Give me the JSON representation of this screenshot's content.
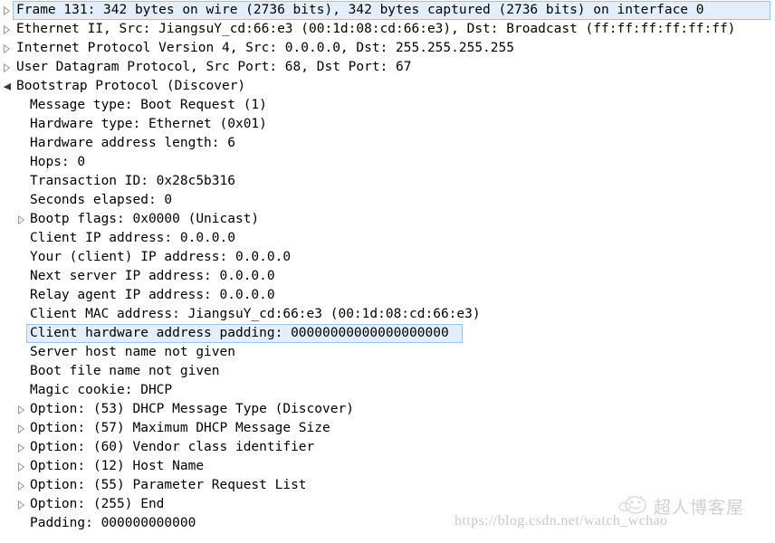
{
  "pane": {
    "name": "Wireshark packet details pane",
    "background": "#ffffff",
    "selection_fill": "#e4eefb",
    "selection_border": "#9fc2e8",
    "text_color": "#000000"
  },
  "tree": {
    "rows": [
      {
        "id": "frame",
        "level": 0,
        "twisty": "collapsed-triangle-icon",
        "selected": true,
        "selection_width": "wide",
        "text": "Frame 131: 342 bytes on wire (2736 bits), 342 bytes captured (2736 bits) on interface 0"
      },
      {
        "id": "ethernet",
        "level": 0,
        "twisty": "collapsed-triangle-icon",
        "selected": false,
        "text": "Ethernet II, Src: JiangsuY_cd:66:e3 (00:1d:08:cd:66:e3), Dst: Broadcast (ff:ff:ff:ff:ff:ff)"
      },
      {
        "id": "ipv4",
        "level": 0,
        "twisty": "collapsed-triangle-icon",
        "selected": false,
        "text": "Internet Protocol Version 4, Src: 0.0.0.0, Dst: 255.255.255.255"
      },
      {
        "id": "udp",
        "level": 0,
        "twisty": "collapsed-triangle-icon",
        "selected": false,
        "text": "User Datagram Protocol, Src Port: 68, Dst Port: 67"
      },
      {
        "id": "bootp",
        "level": 0,
        "twisty": "expanded-triangle-icon",
        "selected": false,
        "text": "Bootstrap Protocol (Discover)"
      },
      {
        "id": "message-type",
        "level": 1,
        "twisty": "none",
        "selected": false,
        "text": "Message type: Boot Request (1)"
      },
      {
        "id": "hardware-type",
        "level": 1,
        "twisty": "none",
        "selected": false,
        "text": "Hardware type: Ethernet (0x01)"
      },
      {
        "id": "hardware-address-length",
        "level": 1,
        "twisty": "none",
        "selected": false,
        "text": "Hardware address length: 6"
      },
      {
        "id": "hops",
        "level": 1,
        "twisty": "none",
        "selected": false,
        "text": "Hops: 0"
      },
      {
        "id": "transaction-id",
        "level": 1,
        "twisty": "none",
        "selected": false,
        "text": "Transaction ID: 0x28c5b316"
      },
      {
        "id": "seconds-elapsed",
        "level": 1,
        "twisty": "none",
        "selected": false,
        "text": "Seconds elapsed: 0"
      },
      {
        "id": "bootp-flags",
        "level": 1,
        "twisty": "collapsed-triangle-icon",
        "selected": false,
        "text": "Bootp flags: 0x0000 (Unicast)"
      },
      {
        "id": "client-ip-address",
        "level": 1,
        "twisty": "none",
        "selected": false,
        "text": "Client IP address: 0.0.0.0"
      },
      {
        "id": "your-client-ip-address",
        "level": 1,
        "twisty": "none",
        "selected": false,
        "text": "Your (client) IP address: 0.0.0.0"
      },
      {
        "id": "next-server-ip-address",
        "level": 1,
        "twisty": "none",
        "selected": false,
        "text": "Next server IP address: 0.0.0.0"
      },
      {
        "id": "relay-agent-ip-address",
        "level": 1,
        "twisty": "none",
        "selected": false,
        "text": "Relay agent IP address: 0.0.0.0"
      },
      {
        "id": "client-mac-address",
        "level": 1,
        "twisty": "none",
        "selected": false,
        "text": "Client MAC address: JiangsuY_cd:66:e3 (00:1d:08:cd:66:e3)"
      },
      {
        "id": "client-hardware-address-padding",
        "level": 1,
        "twisty": "none",
        "selected": true,
        "selection_width": "narrow",
        "text": "Client hardware address padding: 00000000000000000000"
      },
      {
        "id": "server-host-name",
        "level": 1,
        "twisty": "none",
        "selected": false,
        "text": "Server host name not given"
      },
      {
        "id": "boot-file-name",
        "level": 1,
        "twisty": "none",
        "selected": false,
        "text": "Boot file name not given"
      },
      {
        "id": "magic-cookie",
        "level": 1,
        "twisty": "none",
        "selected": false,
        "text": "Magic cookie: DHCP"
      },
      {
        "id": "option-53",
        "level": 1,
        "twisty": "collapsed-triangle-icon",
        "selected": false,
        "text": "Option: (53) DHCP Message Type (Discover)"
      },
      {
        "id": "option-57",
        "level": 1,
        "twisty": "collapsed-triangle-icon",
        "selected": false,
        "text": "Option: (57) Maximum DHCP Message Size"
      },
      {
        "id": "option-60",
        "level": 1,
        "twisty": "collapsed-triangle-icon",
        "selected": false,
        "text": "Option: (60) Vendor class identifier"
      },
      {
        "id": "option-12",
        "level": 1,
        "twisty": "collapsed-triangle-icon",
        "selected": false,
        "text": "Option: (12) Host Name"
      },
      {
        "id": "option-55",
        "level": 1,
        "twisty": "collapsed-triangle-icon",
        "selected": false,
        "text": "Option: (55) Parameter Request List"
      },
      {
        "id": "option-255",
        "level": 1,
        "twisty": "collapsed-triangle-icon",
        "selected": false,
        "text": "Option: (255) End"
      },
      {
        "id": "padding",
        "level": 1,
        "twisty": "none",
        "selected": false,
        "text": "Padding: 000000000000"
      }
    ]
  },
  "watermark": {
    "url": "https://blog.csdn.net/watch_wchao",
    "logo_text": "超人博客屋",
    "logo_icon": "smiley-face-icon",
    "color": "#c9c9c9"
  }
}
